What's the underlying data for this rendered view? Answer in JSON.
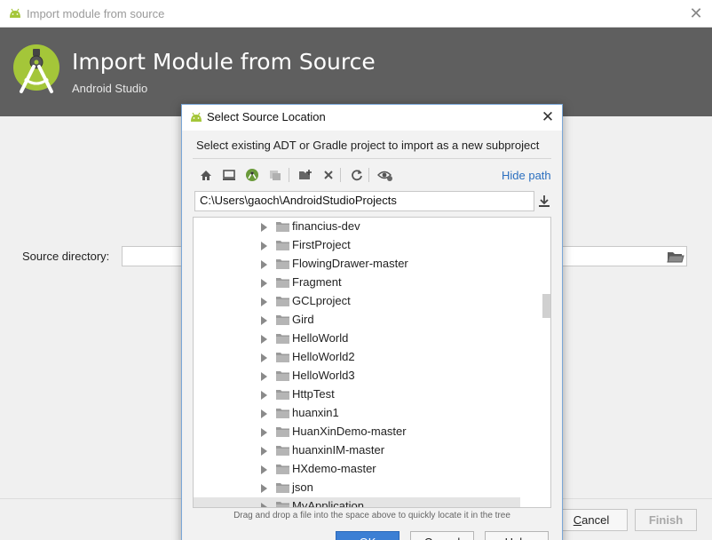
{
  "window": {
    "title": "Import module from source",
    "close_glyph": "✕"
  },
  "header": {
    "title": "Import Module from Source",
    "subtitle": "Android Studio"
  },
  "form": {
    "source_label": "Source directory:",
    "source_value": ""
  },
  "footer": {
    "cancel_prefix": "C",
    "cancel_rest": "ancel",
    "finish_label": "Finish"
  },
  "dialog": {
    "title": "Select Source Location",
    "close_glyph": "✕",
    "description": "Select existing ADT or Gradle project to import as a new subproject",
    "hide_path_label": "Hide path",
    "path_value": "C:\\Users\\gaoch\\AndroidStudioProjects",
    "drag_hint": "Drag and drop a file into the space above to quickly locate it in the tree",
    "ok_label": "OK",
    "cancel_label": "Cancel",
    "help_label": "Help",
    "toolbar_icons": [
      "home-icon",
      "desktop-icon",
      "android-project-icon",
      "module-icon",
      "new-folder-icon",
      "delete-icon",
      "refresh-icon",
      "show-hidden-icon"
    ]
  },
  "tree": {
    "items": [
      "financius-dev",
      "FirstProject",
      "FlowingDrawer-master",
      "Fragment",
      "GCLproject",
      "Gird",
      "HelloWorld",
      "HelloWorld2",
      "HelloWorld3",
      "HttpTest",
      "huanxin1",
      "HuanXinDemo-master",
      "huanxinIM-master",
      "HXdemo-master",
      "json",
      "MyApplication"
    ]
  },
  "colors": {
    "header_bg": "#5f5f5f",
    "android_green": "#a4c639",
    "link_blue": "#2b6fbf"
  }
}
